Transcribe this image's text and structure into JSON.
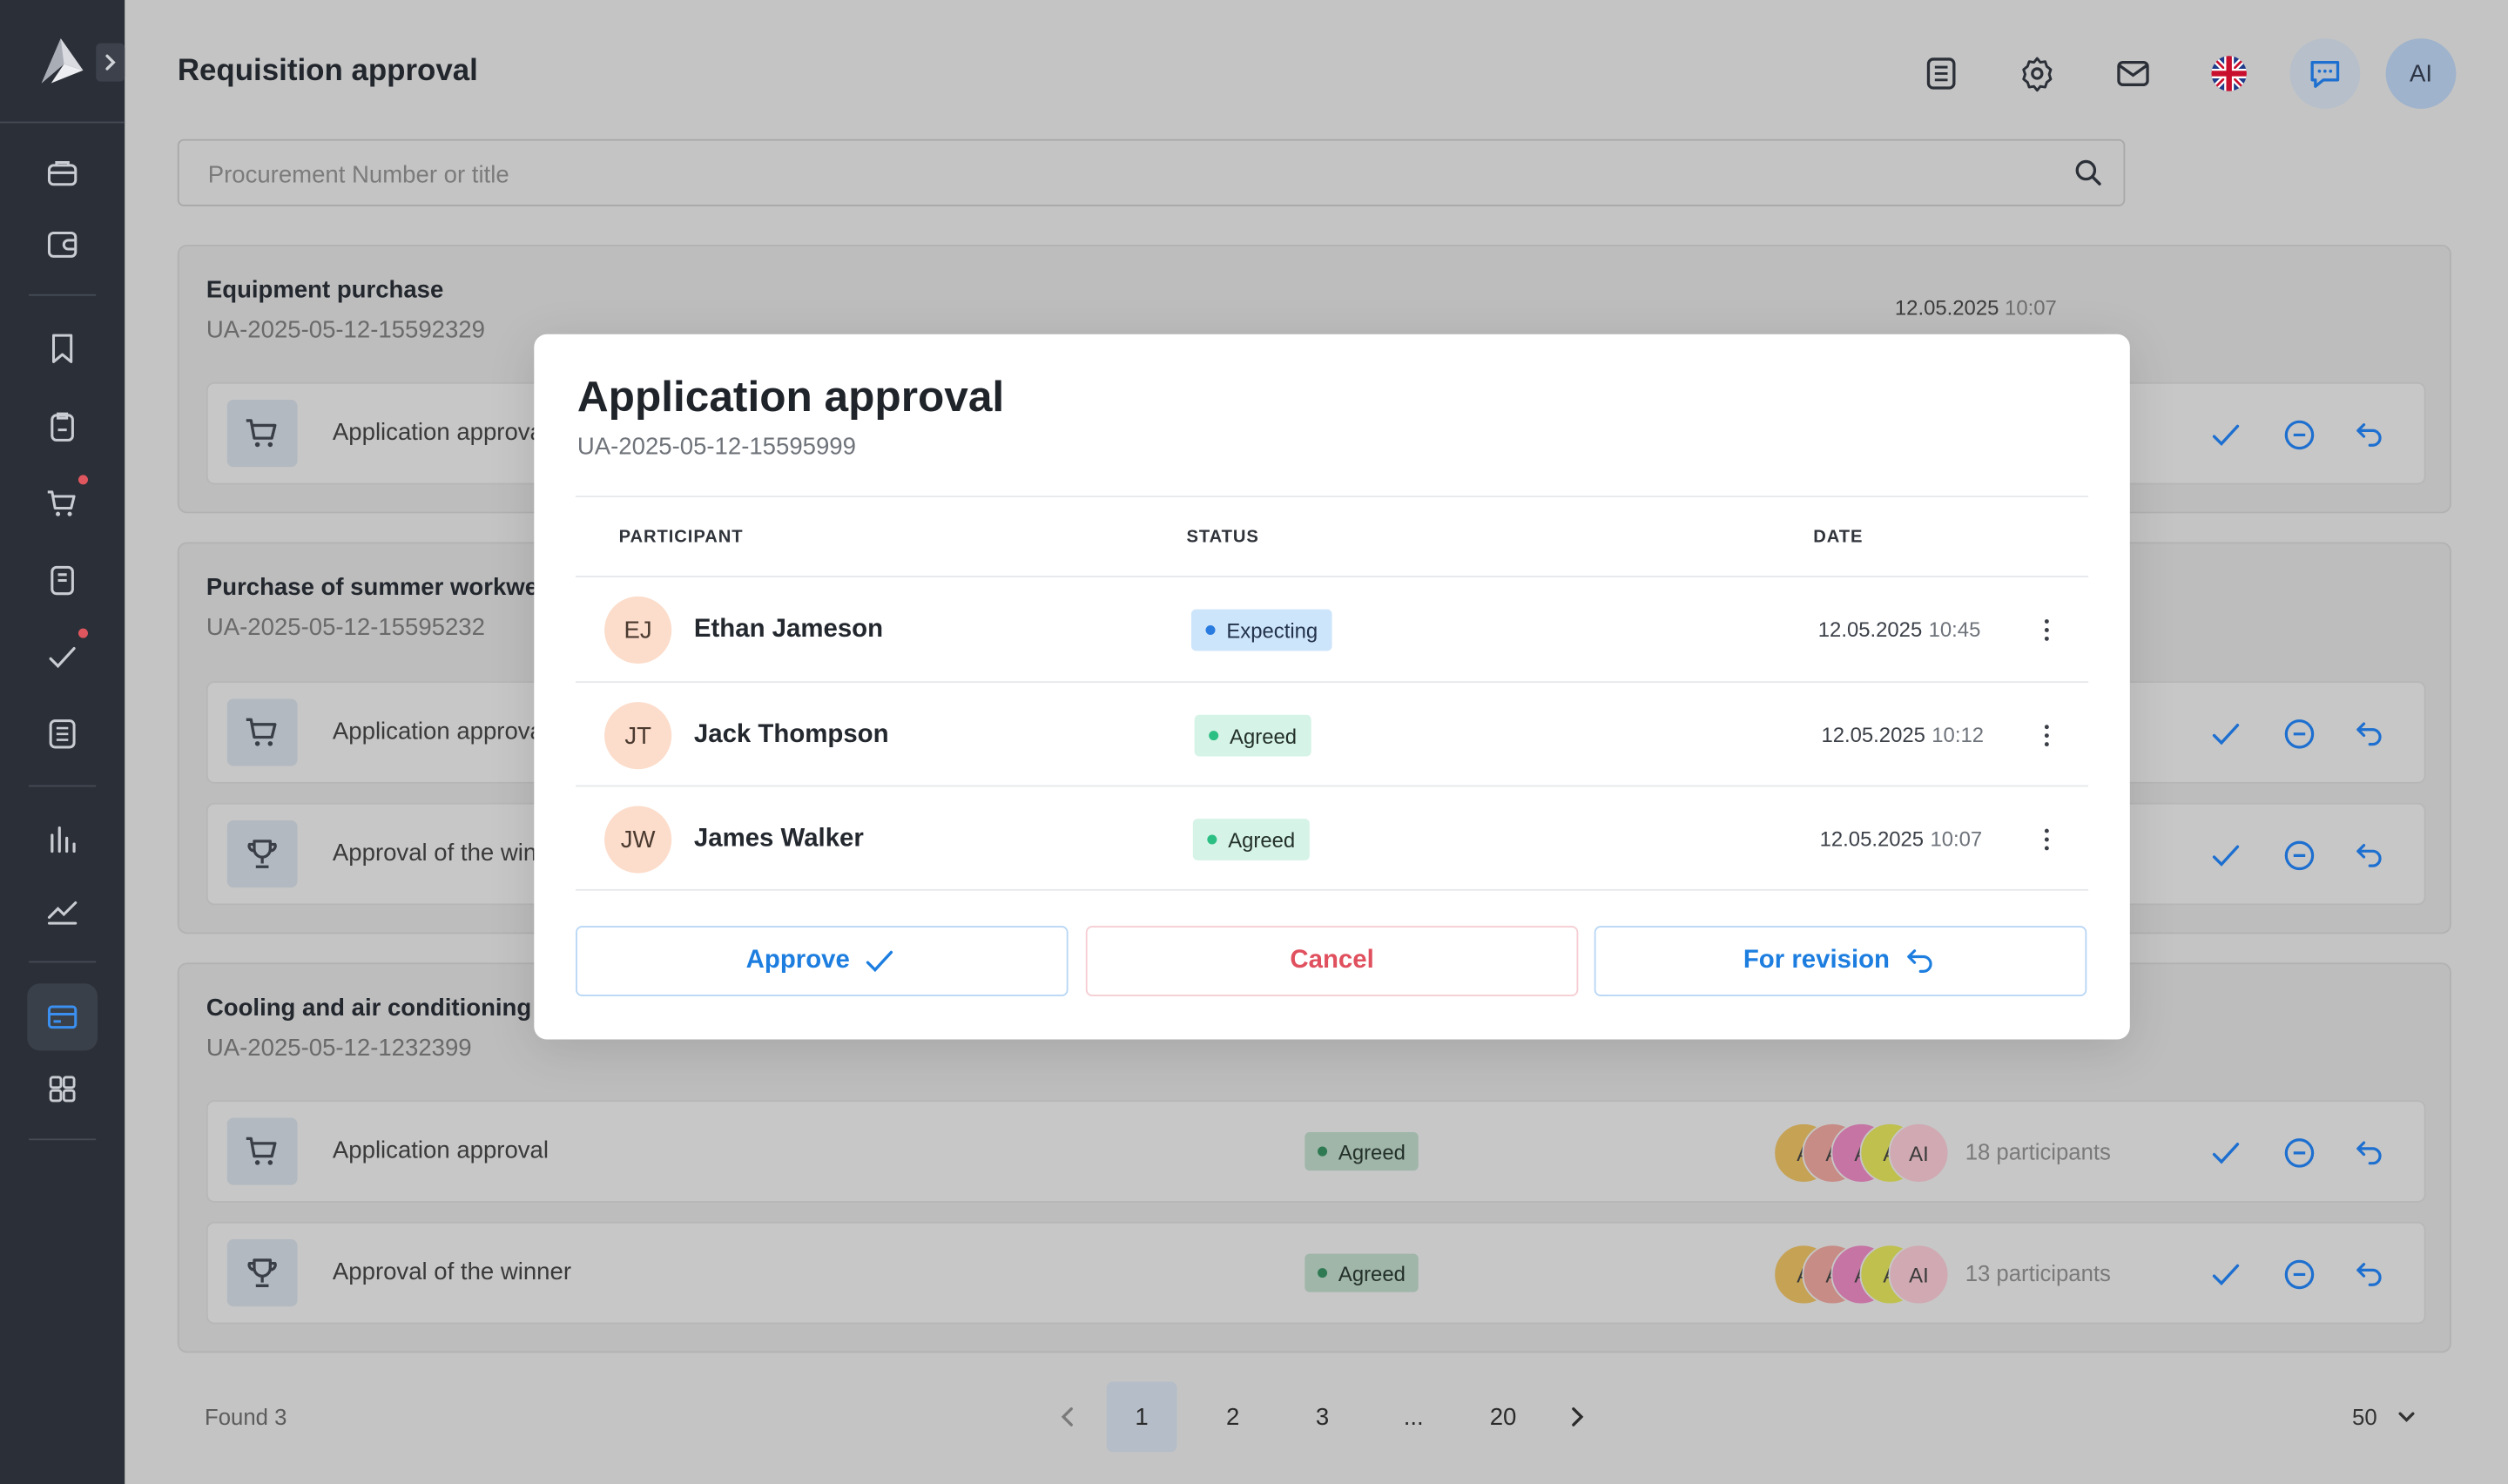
{
  "page": {
    "title": "Requisition approval"
  },
  "header": {
    "icons": [
      "document-icon",
      "gear-icon",
      "mail-icon",
      "uk-flag-icon",
      "chat-icon"
    ],
    "user_initials": "AI"
  },
  "search": {
    "placeholder": "Procurement Number or title",
    "value": ""
  },
  "cards": [
    {
      "title": "Equipment purchase",
      "number": "UA-2025-05-12-15592329",
      "date": "12.05.2025",
      "time": "10:07",
      "rows": [
        {
          "icon": "cart-icon",
          "title": "Application approval"
        }
      ]
    },
    {
      "title": "Purchase of summer workwear",
      "number": "UA-2025-05-12-15595232",
      "rows": [
        {
          "icon": "cart-icon",
          "title": "Application approval"
        },
        {
          "icon": "trophy-icon",
          "title": "Approval of the winner"
        }
      ]
    },
    {
      "title": "Cooling and air conditioning",
      "number": "UA-2025-05-12-1232399",
      "rows": [
        {
          "icon": "cart-icon",
          "title": "Application approval",
          "status": "Agreed",
          "avatars": [
            "A",
            "A",
            "A",
            "A",
            "AI"
          ],
          "participants": "18 participants"
        },
        {
          "icon": "trophy-icon",
          "title": "Approval of the winner",
          "status": "Agreed",
          "avatars": [
            "A",
            "A",
            "A",
            "A",
            "AI"
          ],
          "participants": "13 participants"
        }
      ]
    }
  ],
  "footer": {
    "found": "Found 3",
    "pages": [
      "1",
      "2",
      "3",
      "...",
      "20"
    ],
    "current_page": "1",
    "per_page": "50"
  },
  "modal": {
    "title": "Application approval",
    "number": "UA-2025-05-12-15595999",
    "columns": {
      "participant": "PARTICIPANT",
      "status": "STATUS",
      "date": "DATE"
    },
    "participants": [
      {
        "initials": "EJ",
        "name": "Ethan Jameson",
        "status": "Expecting",
        "date": "12.05.2025",
        "time": "10:45"
      },
      {
        "initials": "JT",
        "name": "Jack Thompson",
        "status": "Agreed",
        "date": "12.05.2025",
        "time": "10:12"
      },
      {
        "initials": "JW",
        "name": "James Walker",
        "status": "Agreed",
        "date": "12.05.2025",
        "time": "10:07"
      }
    ],
    "buttons": {
      "approve": "Approve",
      "cancel": "Cancel",
      "revision": "For revision"
    }
  },
  "colors": {
    "sidebar": "#2b2f37",
    "accent": "#1d7ee0",
    "cancel": "#e0505e",
    "agreed_bg": "#d6f3e7",
    "expecting_bg": "#cde5fb",
    "avatar_bg": "#fcdcca",
    "notification_dot": "#e0565e"
  }
}
